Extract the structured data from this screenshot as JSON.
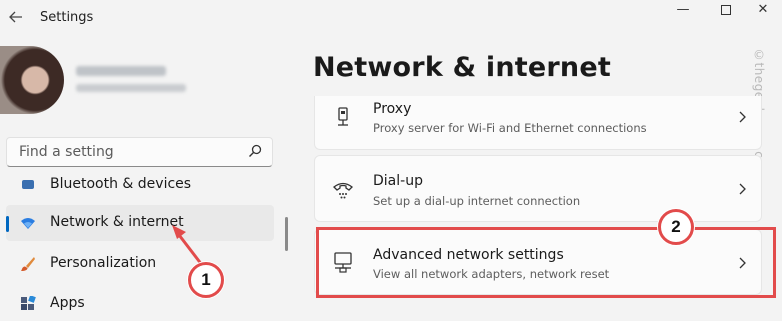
{
  "window": {
    "title": "Settings",
    "controls": {
      "minimize": "—",
      "close": "✕"
    }
  },
  "sidebar": {
    "search": {
      "placeholder": "Find a setting"
    },
    "items": [
      {
        "label": "Bluetooth & devices",
        "icon": "bluetooth-icon"
      },
      {
        "label": "Network & internet",
        "icon": "wifi-icon",
        "active": true
      },
      {
        "label": "Personalization",
        "icon": "brush-icon"
      },
      {
        "label": "Apps",
        "icon": "apps-icon"
      }
    ]
  },
  "main": {
    "title": "Network & internet",
    "cards": [
      {
        "title": "Proxy",
        "description": "Proxy server for Wi-Fi and Ethernet connections",
        "icon": "proxy-icon"
      },
      {
        "title": "Dial-up",
        "description": "Set up a dial-up internet connection",
        "icon": "dialup-icon"
      },
      {
        "title": "Advanced network settings",
        "description": "View all network adapters, network reset",
        "icon": "network-adapter-icon"
      }
    ]
  },
  "annotations": {
    "step1": "1",
    "step2": "2",
    "highlight_color": "#e24b4b"
  },
  "watermark": "©thegeekpage.com",
  "colors": {
    "accent": "#0067c0",
    "background": "#f3f3f3",
    "card": "#fbfbfb"
  }
}
